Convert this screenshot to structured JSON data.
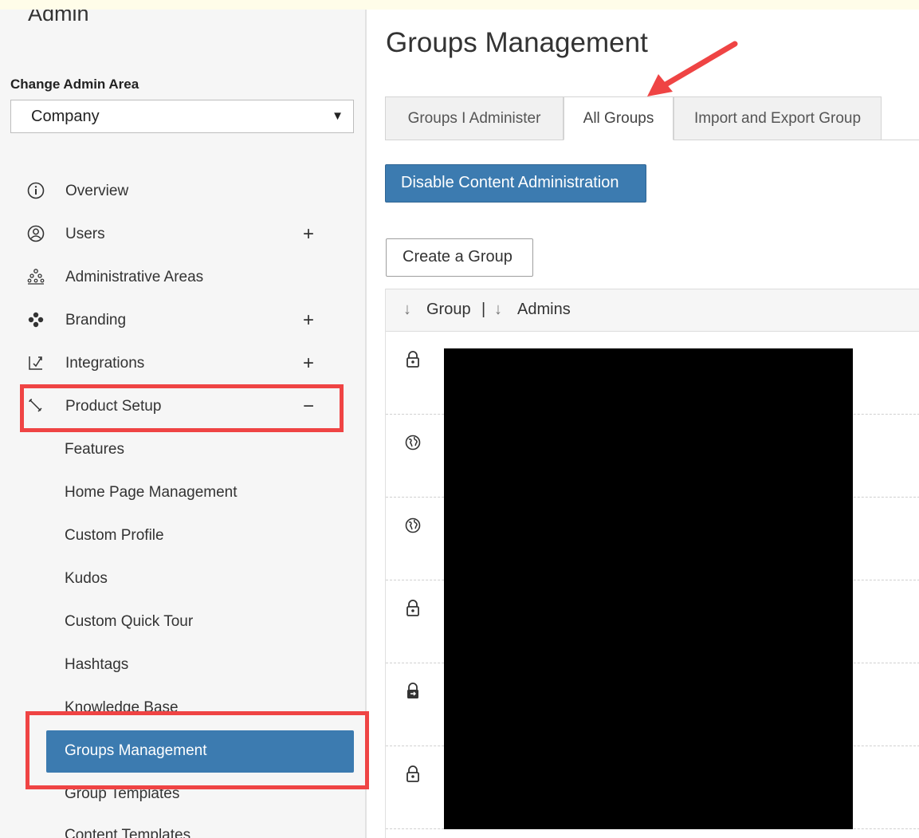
{
  "sidebar": {
    "admin_title": "Admin",
    "change_label": "Change Admin Area",
    "area_value": "Company",
    "nav": [
      {
        "label": "Overview",
        "icon": "info-icon",
        "toggle": ""
      },
      {
        "label": "Users",
        "icon": "user-icon",
        "toggle": "+"
      },
      {
        "label": "Administrative Areas",
        "icon": "org-chart-icon",
        "toggle": ""
      },
      {
        "label": "Branding",
        "icon": "palette-icon",
        "toggle": "+"
      },
      {
        "label": "Integrations",
        "icon": "integration-icon",
        "toggle": "+"
      },
      {
        "label": "Product Setup",
        "icon": "wrench-icon",
        "toggle": "−"
      }
    ],
    "sub": [
      "Features",
      "Home Page Management",
      "Custom Profile",
      "Kudos",
      "Custom Quick Tour",
      "Hashtags",
      "Knowledge Base",
      "Groups Management",
      "Group Templates",
      "Content Templates"
    ]
  },
  "main": {
    "title": "Groups Management",
    "tabs": [
      "Groups I Administer",
      "All Groups",
      "Import and Export Group"
    ],
    "disable_btn": "Disable Content Administration",
    "create_btn": "Create a Group",
    "columns": {
      "group": "Group",
      "sep": "|",
      "admins": "Admins"
    },
    "rows": [
      {
        "icon": "lock-icon"
      },
      {
        "icon": "globe-icon"
      },
      {
        "icon": "globe-icon"
      },
      {
        "icon": "lock-icon"
      },
      {
        "icon": "lock-share-icon"
      },
      {
        "icon": "lock-icon"
      }
    ]
  },
  "colors": {
    "accent": "#3c7bb0",
    "highlight": "#ef4444"
  }
}
